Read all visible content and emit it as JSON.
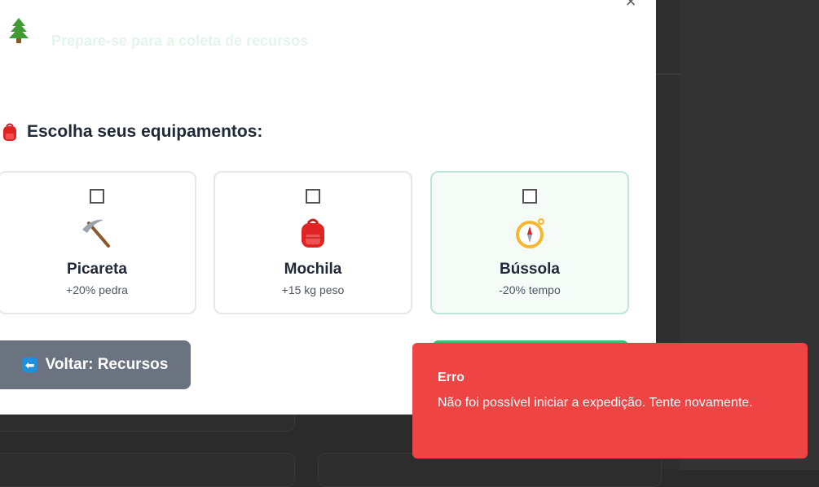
{
  "modal": {
    "subtitle": "Prepare-se para a coleta de recursos",
    "close_label": "×",
    "section_title": "Escolha seus equipamentos:",
    "equipment": [
      {
        "name": "Picareta",
        "effect": "+20% pedra",
        "icon": "pickaxe-icon",
        "checked": false
      },
      {
        "name": "Mochila",
        "effect": "+15 kg peso",
        "icon": "backpack-icon",
        "checked": false
      },
      {
        "name": "Bússola",
        "effect": "-20% tempo",
        "icon": "compass-icon",
        "checked": false
      }
    ],
    "back_button": {
      "label": "Voltar: Recursos",
      "arrow": "⬅"
    }
  },
  "toast": {
    "title": "Erro",
    "message": "Não foi possível iniciar a expedição. Tente novamente."
  },
  "colors": {
    "error": "#ef4444",
    "back_button": "#6b7280",
    "accent_green": "#34c27b"
  }
}
